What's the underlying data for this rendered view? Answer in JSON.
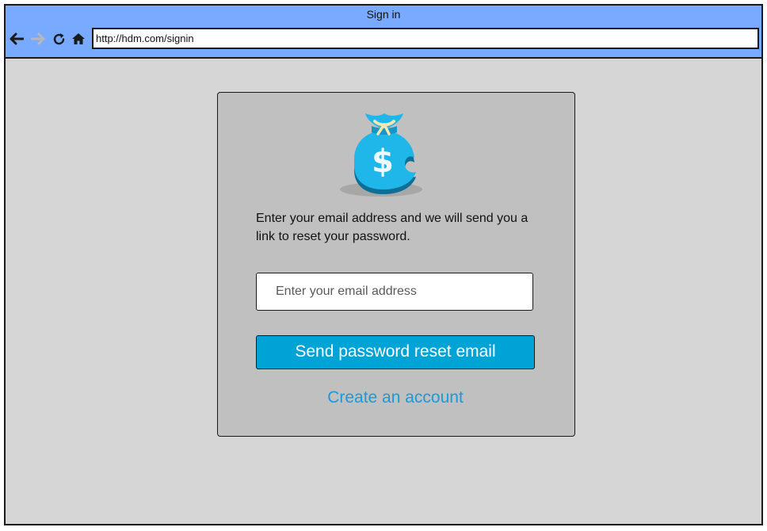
{
  "window": {
    "title": "Sign in",
    "titlebar_color": "#78aaff",
    "background_color": "#d6d6d6"
  },
  "toolbar": {
    "back_icon": "arrow-left-icon",
    "forward_icon": "arrow-right-icon",
    "forward_enabled": false,
    "reload_icon": "refresh-icon",
    "home_icon": "home-icon",
    "url": "http://hdm.com/signin"
  },
  "card": {
    "logo_icon": "money-bag-icon",
    "logo_color": "#1fb6ea",
    "instructions": "Enter your email address and we will send you a link to reset your password.",
    "email_placeholder": "Enter your email address",
    "email_value": "",
    "submit_label": "Send password reset email",
    "submit_color": "#00a3d6",
    "create_account_label": "Create an account",
    "link_color": "#1a9ad6"
  }
}
